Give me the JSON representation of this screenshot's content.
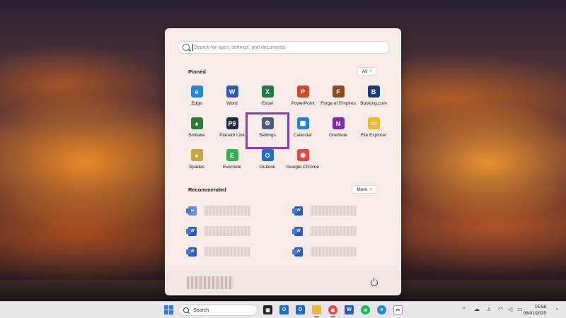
{
  "search": {
    "placeholder": "Search for apps, settings, and documents"
  },
  "pinned": {
    "title": "Pinned",
    "all_label": "All",
    "apps": [
      {
        "label": "Edge",
        "icon": "edge-icon",
        "color": "#1f8ad8",
        "glyph": "e"
      },
      {
        "label": "Word",
        "icon": "word-icon",
        "color": "#2b5cb8",
        "glyph": "W"
      },
      {
        "label": "Excel",
        "icon": "excel-icon",
        "color": "#1e7a44",
        "glyph": "X"
      },
      {
        "label": "PowerPoint",
        "icon": "powerpoint-icon",
        "color": "#d24726",
        "glyph": "P"
      },
      {
        "label": "Forge of Empires",
        "icon": "forge-of-empires-icon",
        "color": "#8a4b1f",
        "glyph": "F"
      },
      {
        "label": "Booking.com",
        "icon": "booking-icon",
        "color": "#1a3a7a",
        "glyph": "B"
      },
      {
        "label": "Solitaire",
        "icon": "solitaire-icon",
        "color": "#2f7a3a",
        "glyph": "♠"
      },
      {
        "label": "Planet9 Link",
        "icon": "planet9-link-icon",
        "color": "#1f2b45",
        "glyph": "P9"
      },
      {
        "label": "Settings",
        "icon": "gear-icon",
        "color": "#4a5a72",
        "glyph": "⚙"
      },
      {
        "label": "Calendar",
        "icon": "calendar-icon",
        "color": "#2b7bd8",
        "glyph": "▦"
      },
      {
        "label": "OneNote",
        "icon": "onenote-icon",
        "color": "#7a2fa8",
        "glyph": "N"
      },
      {
        "label": "File Explorer",
        "icon": "folder-icon",
        "color": "#e8b93a",
        "glyph": "▭"
      },
      {
        "label": "Spades",
        "icon": "spades-icon",
        "color": "#c9a23a",
        "glyph": "♠"
      },
      {
        "label": "Evernote",
        "icon": "evernote-icon",
        "color": "#2bb04a",
        "glyph": "E"
      },
      {
        "label": "Outlook",
        "icon": "outlook-icon",
        "color": "#1f6cc4",
        "glyph": "O"
      },
      {
        "label": "Google Chrome",
        "icon": "chrome-icon",
        "color": "#e8453c",
        "glyph": "◉"
      }
    ]
  },
  "recommended": {
    "title": "Recommended",
    "more_label": "More"
  },
  "taskbar": {
    "search_label": "Search",
    "time": "15:58",
    "date": "08/01/2025"
  },
  "colors": {
    "highlight": "#8a3bbd",
    "accent": "#2d7de0"
  }
}
